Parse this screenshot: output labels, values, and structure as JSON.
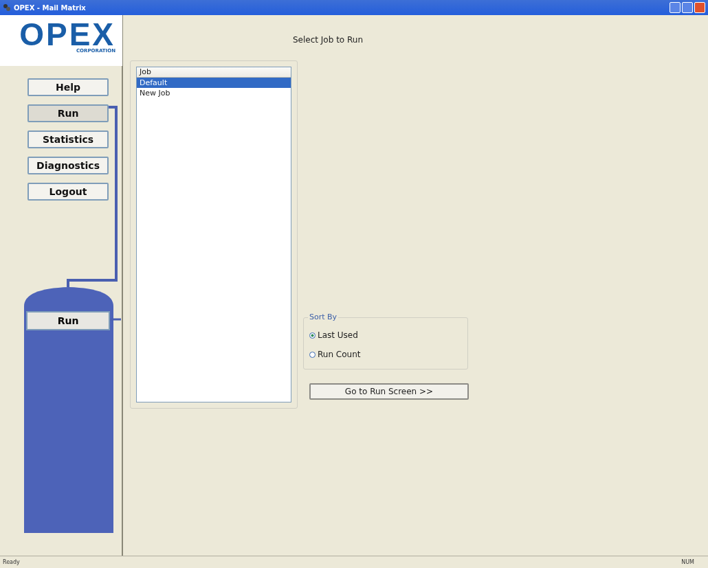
{
  "window": {
    "title": "OPEX - Mail Matrix"
  },
  "logo": {
    "name": "OPEX",
    "subtitle": "CORPORATION"
  },
  "nav": [
    {
      "label": "Help",
      "selected": false
    },
    {
      "label": "Run",
      "selected": true
    },
    {
      "label": "Statistics",
      "selected": false
    },
    {
      "label": "Diagnostics",
      "selected": false
    },
    {
      "label": "Logout",
      "selected": false
    }
  ],
  "tank": {
    "label": "Run"
  },
  "heading": "Select Job to Run",
  "job_list": {
    "header": "Job",
    "rows": [
      {
        "label": "Default",
        "selected": true
      },
      {
        "label": "New Job",
        "selected": false
      }
    ]
  },
  "sort_by": {
    "title": "Sort By",
    "options": [
      {
        "label": "Last Used",
        "checked": true
      },
      {
        "label": "Run Count",
        "checked": false
      }
    ]
  },
  "go_button": "Go to Run Screen >>",
  "status_bar": {
    "left": "Ready",
    "right": "NUM"
  }
}
